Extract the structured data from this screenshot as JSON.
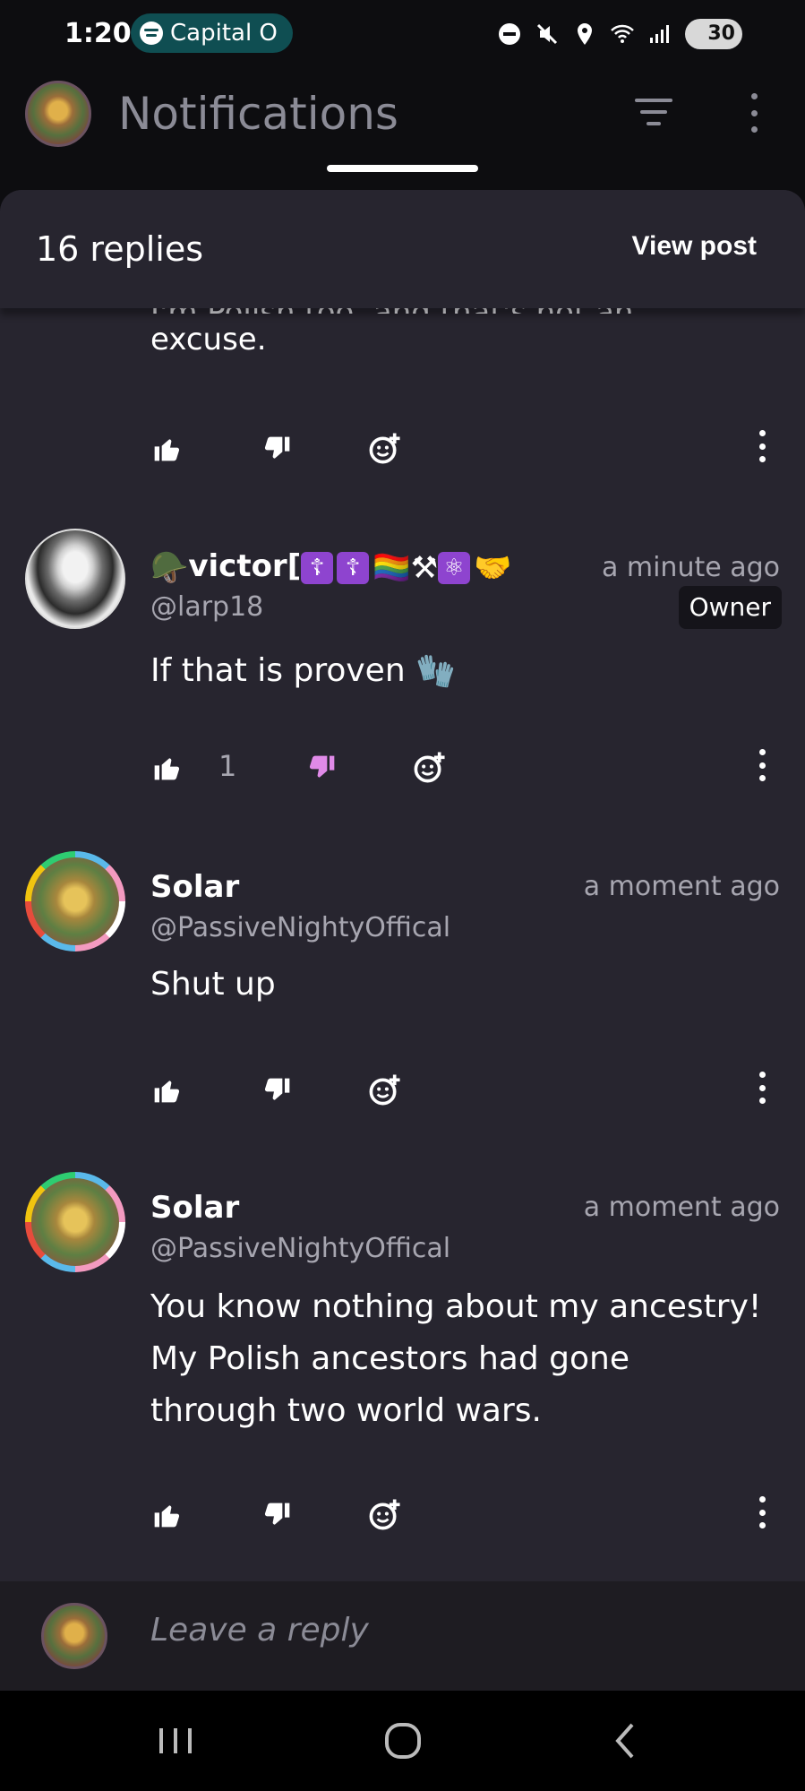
{
  "status_bar": {
    "time": "1:20",
    "media_pill_label": "Capital O",
    "battery": "30",
    "icons": [
      "dnd-icon",
      "mute-icon",
      "location-icon",
      "wifi-icon",
      "signal-icon",
      "battery-icon"
    ]
  },
  "header": {
    "title": "Notifications",
    "filter_icon": "filter-icon",
    "more_icon": "more-vertical-icon"
  },
  "sheet": {
    "replies_count": "16 replies",
    "view_post_label": "View post"
  },
  "partial_comment": {
    "hidden_line": "I'm Polish too, and that's not an",
    "last_line": "excuse."
  },
  "comments": [
    {
      "name": "victor[",
      "name_emojis": [
        "☦",
        "☦",
        "🏳",
        "⚒",
        "⚛",
        "🤝"
      ],
      "time": "a minute ago",
      "handle": "@larp18",
      "badge": "Owner",
      "body": "If that is proven",
      "body_emoji": "🧤",
      "like_count": "1",
      "disliked": true
    },
    {
      "name": "Solar",
      "time": "a moment ago",
      "handle": "@PassiveNightyOffical",
      "body": "Shut up"
    },
    {
      "name": "Solar",
      "time": "a moment ago",
      "handle": "@PassiveNightyOffical",
      "body_lines": [
        "You know nothing about my ancestry!",
        "My Polish ancestors had gone",
        "through two world wars."
      ]
    }
  ],
  "reply_bar": {
    "placeholder": "Leave a reply"
  },
  "colors": {
    "sheet_bg": "#27252f",
    "accent_dislike": "#e08ae8",
    "muted_text": "#a7a6b0"
  }
}
